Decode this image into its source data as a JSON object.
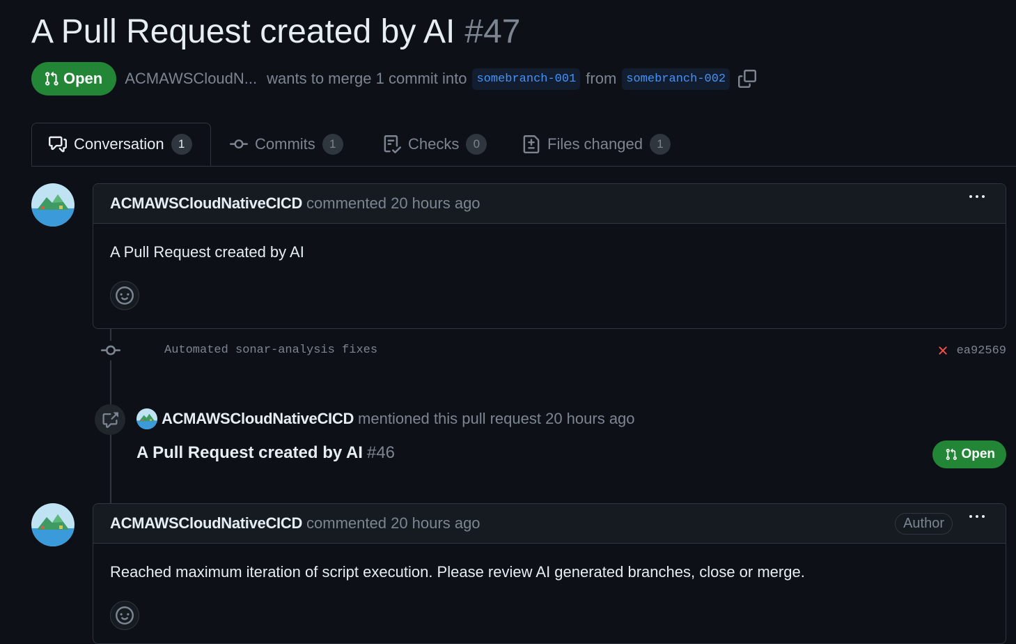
{
  "pr": {
    "title": "A Pull Request created by AI",
    "number": "#47",
    "state": "Open",
    "author": "ACMAWSCloudN...",
    "merge_text_1": "wants to merge 1 commit into",
    "base_branch": "somebranch-001",
    "merge_text_2": "from",
    "head_branch": "somebranch-002"
  },
  "tabs": [
    {
      "label": "Conversation",
      "count": "1",
      "icon": "comment-discussion-icon"
    },
    {
      "label": "Commits",
      "count": "1",
      "icon": "git-commit-icon"
    },
    {
      "label": "Checks",
      "count": "0",
      "icon": "checklist-icon"
    },
    {
      "label": "Files changed",
      "count": "1",
      "icon": "file-diff-icon"
    }
  ],
  "timeline": {
    "comment1": {
      "author": "ACMAWSCloudNativeCICD",
      "action": "commented 20 hours ago",
      "body": "A Pull Request created by AI"
    },
    "commit": {
      "message": "Automated sonar-analysis fixes",
      "sha": "ea92569",
      "status": "failed"
    },
    "mention": {
      "author": "ACMAWSCloudNativeCICD",
      "action": "mentioned this pull request 20 hours ago",
      "ref_title": "A Pull Request created by AI",
      "ref_number": "#46",
      "ref_state": "Open"
    },
    "comment2": {
      "author": "ACMAWSCloudNativeCICD",
      "action": "commented 20 hours ago",
      "badge": "Author",
      "body": "Reached maximum iteration of script execution. Please review AI generated branches, close or merge."
    }
  },
  "colors": {
    "background": "#0d1117",
    "open_green": "#238636",
    "branch_blue": "#4493f8",
    "muted": "#7d8590",
    "fail_red": "#f85149"
  }
}
